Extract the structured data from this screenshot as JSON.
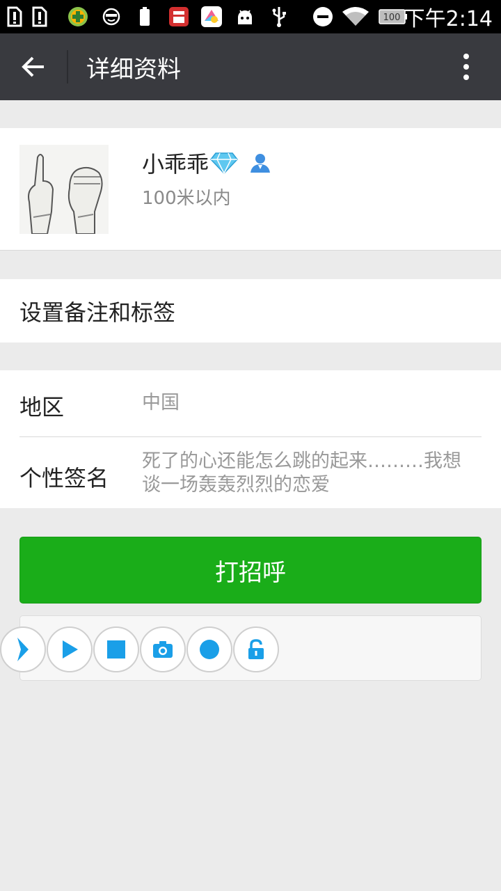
{
  "status_bar": {
    "battery_level": "100",
    "time": "下午2:14",
    "icons": [
      "sim-card-icon",
      "sim-card-icon",
      "plus-app-icon",
      "face-app-icon",
      "battery-small-icon",
      "news-app-icon",
      "colorful-app-icon",
      "android-icon",
      "usb-icon",
      "do-not-disturb-icon",
      "wifi-icon",
      "battery-icon"
    ]
  },
  "header": {
    "title": "详细资料",
    "back_icon": "arrow-left-icon",
    "more_icon": "more-vertical-icon"
  },
  "profile": {
    "name": "小乖乖",
    "badge_icon": "diamond-icon",
    "contact_icon": "person-icon",
    "distance": "100米以内"
  },
  "remark": {
    "label": "设置备注和标签"
  },
  "info": {
    "region_label": "地区",
    "region_value": "中国",
    "signature_label": "个性签名",
    "signature_value": "死了的心还能怎么跳的起来………我想谈一场轰轰烈烈的恋爱"
  },
  "actions": {
    "greet_label": "打招呼"
  },
  "floating_toolbar": {
    "buttons": [
      "chevron-right-icon",
      "play-icon",
      "stop-icon",
      "camera-icon",
      "record-icon",
      "unlock-icon"
    ]
  },
  "colors": {
    "status_bar": "#000000",
    "title_bar": "#393a3f",
    "background": "#ebebeb",
    "primary_green": "#1aad19",
    "toolbar_blue": "#1a9fe8"
  }
}
